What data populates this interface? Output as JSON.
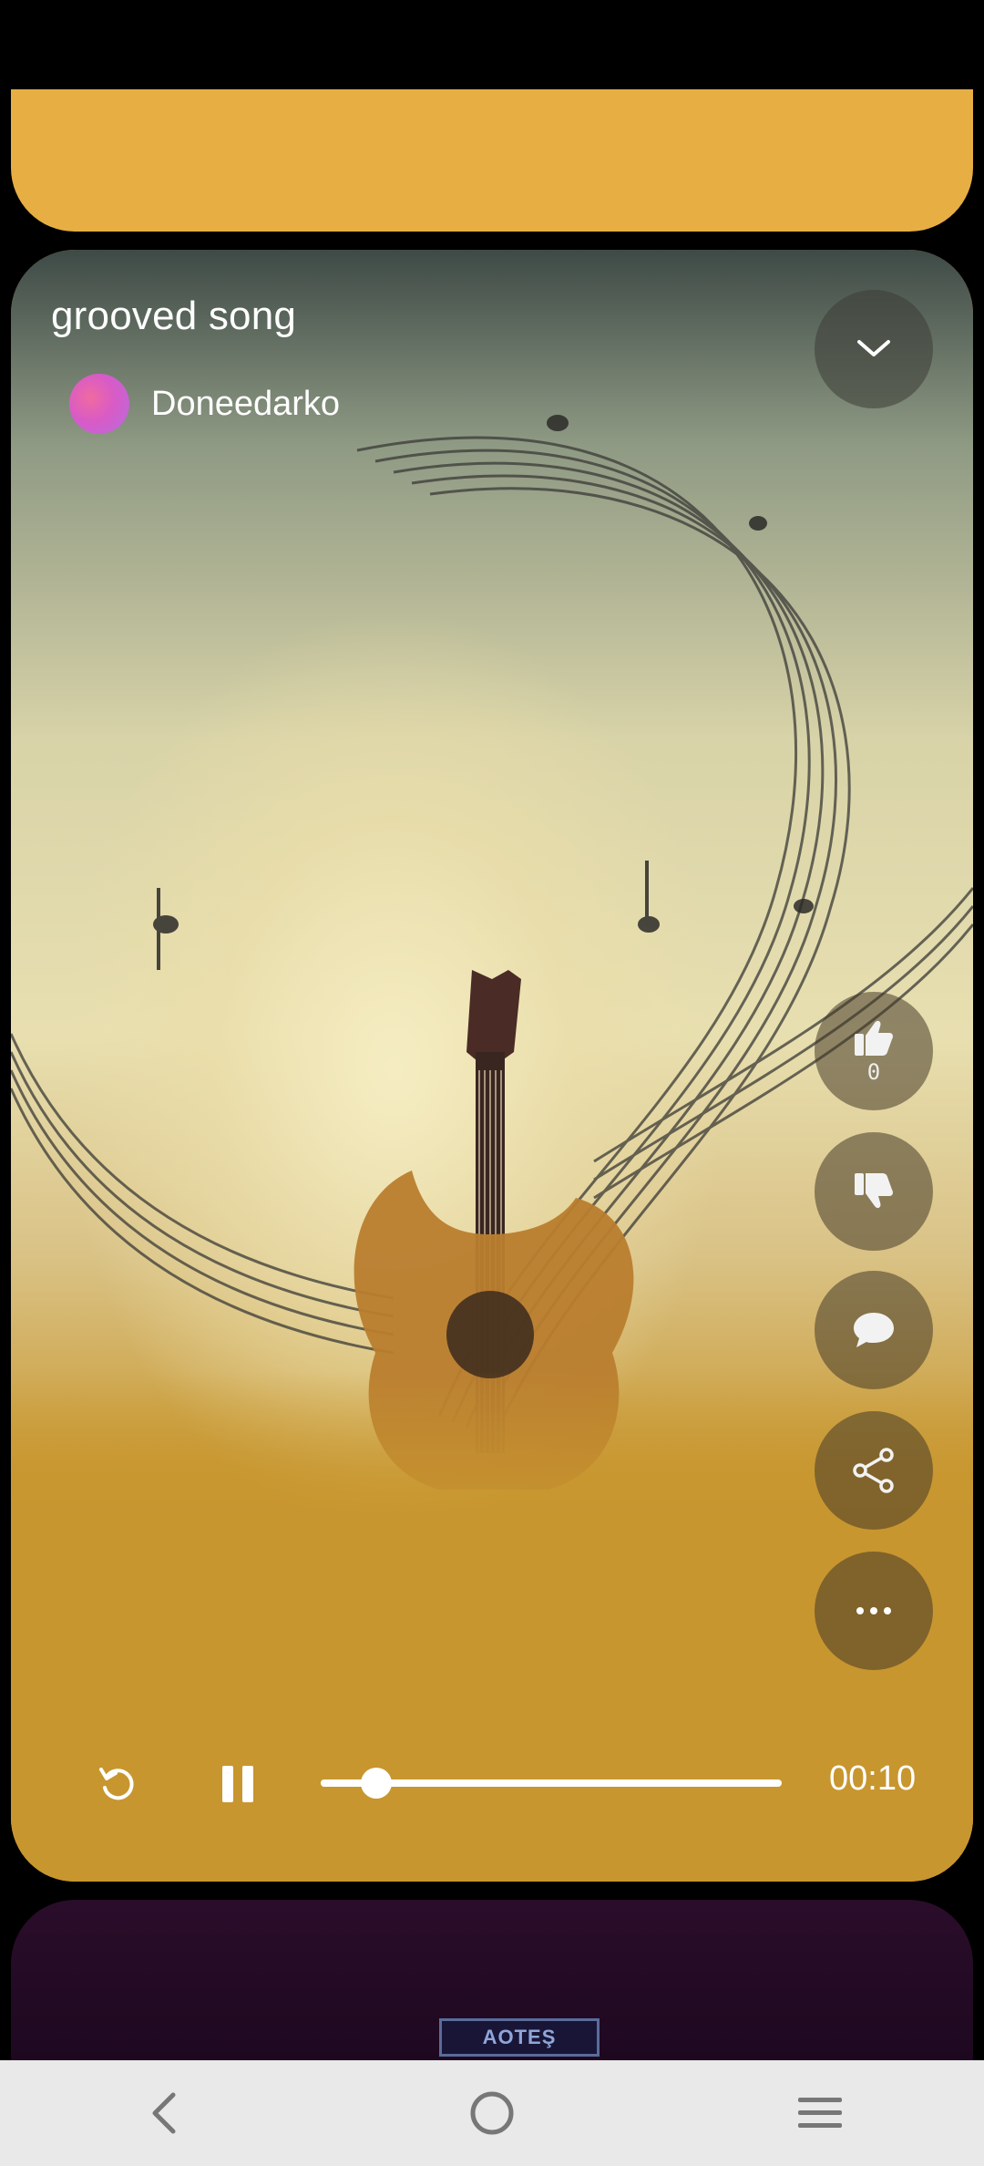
{
  "player": {
    "title": "grooved song",
    "artist": "Doneedarko",
    "like_count": "0",
    "current_time": "00:10",
    "progress_fraction": 0.12
  },
  "icons": {
    "collapse": "chevron-down-icon",
    "like": "thumbs-up-icon",
    "dislike": "thumbs-down-icon",
    "comment": "comment-icon",
    "share": "share-icon",
    "more": "more-icon",
    "replay": "replay-icon",
    "pause": "pause-icon"
  },
  "next_preview": {
    "sign_text": "AOTEŞ"
  },
  "navbar": {
    "back": "back-icon",
    "home": "home-icon",
    "menu": "menu-icon"
  },
  "colors": {
    "card_bg": "#C8962F",
    "prev_card_bg": "#E6AE43",
    "navbar_bg": "#E9E9E9"
  }
}
